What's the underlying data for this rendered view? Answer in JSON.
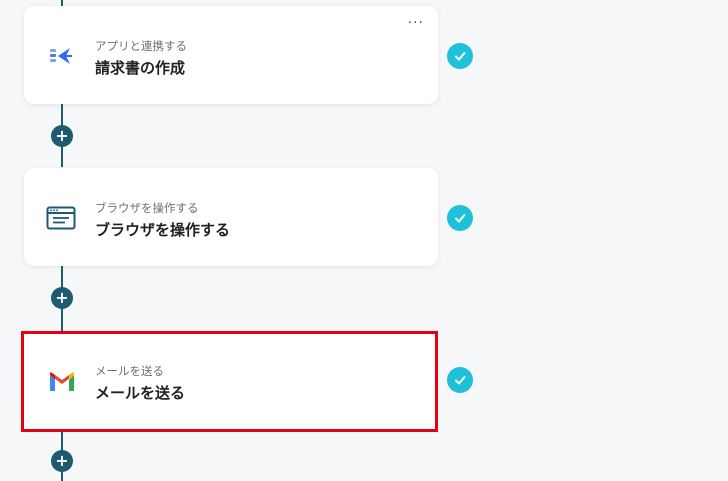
{
  "steps": [
    {
      "subtitle": "アプリと連携する",
      "title": "請求書の作成",
      "icon": "invoice-app-icon",
      "status": "completed",
      "menu_label": "···"
    },
    {
      "subtitle": "ブラウザを操作する",
      "title": "ブラウザを操作する",
      "icon": "browser-window-icon",
      "status": "completed"
    },
    {
      "subtitle": "メールを送る",
      "title": "メールを送る",
      "icon": "gmail-icon",
      "status": "completed",
      "selected": true
    }
  ],
  "add_label": "+",
  "colors": {
    "connector": "#1f5a6e",
    "check": "#1fc1d8",
    "highlight": "#e60012"
  }
}
